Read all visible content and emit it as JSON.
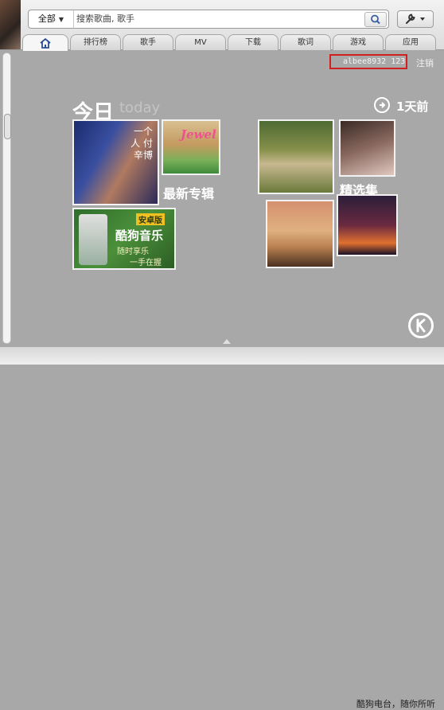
{
  "search": {
    "scope_label": "全部",
    "placeholder": "搜索歌曲, 歌手"
  },
  "tabs": [
    {
      "label": ""
    },
    {
      "label": "排行榜"
    },
    {
      "label": "歌手"
    },
    {
      "label": "MV"
    },
    {
      "label": "下载"
    },
    {
      "label": "歌词"
    },
    {
      "label": "游戏"
    },
    {
      "label": "应用"
    }
  ],
  "user": {
    "username": "albee8932 123",
    "logout_label": "注销"
  },
  "header": {
    "today_cn": "今日",
    "today_en": "today",
    "prev_day_label": "1天前"
  },
  "tiles": {
    "album1_title": "一个人 付辛博",
    "album2_title": "Jewel",
    "app_badge": "安卓版",
    "app_name": "酷狗音乐",
    "app_slogan_1": "随时享乐",
    "app_slogan_2": "一手在握"
  },
  "sections": {
    "new_albums": "最新专辑",
    "featured": "精选集"
  },
  "footer": {
    "text": "酷狗电台，随你所听"
  },
  "icons": {
    "home": "home-icon",
    "search": "search-icon",
    "tools": "wrench-icon",
    "prev": "arrow-right-circle-icon",
    "logo": "kugou-logo-icon"
  }
}
